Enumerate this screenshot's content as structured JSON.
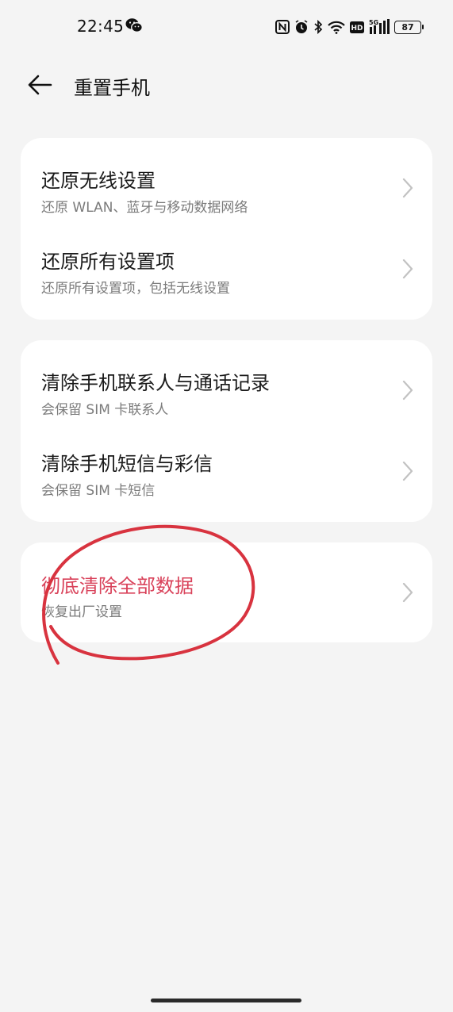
{
  "status_bar": {
    "time": "22:45",
    "battery": "87",
    "icons": [
      "wechat-icon",
      "nfc-icon",
      "alarm-icon",
      "bluetooth-icon",
      "wifi-icon",
      "hd-icon",
      "signal-5g-icon",
      "battery-icon"
    ]
  },
  "header": {
    "back_icon": "arrow-left-icon",
    "title": "重置手机"
  },
  "groups": [
    {
      "items": [
        {
          "title": "还原无线设置",
          "subtitle": "还原 WLAN、蓝牙与移动数据网络"
        },
        {
          "title": "还原所有设置项",
          "subtitle": "还原所有设置项，包括无线设置"
        }
      ]
    },
    {
      "items": [
        {
          "title": "清除手机联系人与通话记录",
          "subtitle": "会保留 SIM 卡联系人"
        },
        {
          "title": "清除手机短信与彩信",
          "subtitle": "会保留 SIM 卡短信"
        }
      ]
    },
    {
      "items": [
        {
          "title": "彻底清除全部数据",
          "subtitle": "恢复出厂设置"
        }
      ]
    }
  ],
  "colors": {
    "background": "#f4f4f4",
    "card": "#ffffff",
    "danger_text": "#d9425a",
    "annotation_stroke": "#d8333f"
  }
}
